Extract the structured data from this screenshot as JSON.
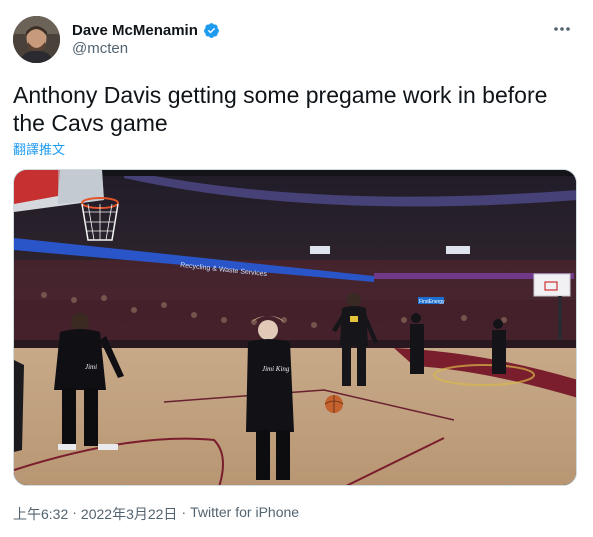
{
  "author": {
    "display_name": "Dave McMenamin",
    "handle": "@mcten",
    "verified_icon": "verified-badge-icon",
    "badge_color": "#1d9bf0"
  },
  "tweet": {
    "text": "Anthony Davis getting some pregame work in before the Cavs game",
    "translate_label": "翻譯推文"
  },
  "media": {
    "banner_text": "Recycling & Waste Services",
    "sign_text": "FirstEnergy",
    "shirt_text_left": "Jimi",
    "shirt_text_center": "Jimi King"
  },
  "footer": {
    "time": "上午6:32",
    "separator": "·",
    "date": "2022年3月22日",
    "source": "Twitter for iPhone"
  },
  "colors": {
    "text_primary": "#0f1419",
    "text_secondary": "#536471",
    "link": "#1d9bf0"
  }
}
